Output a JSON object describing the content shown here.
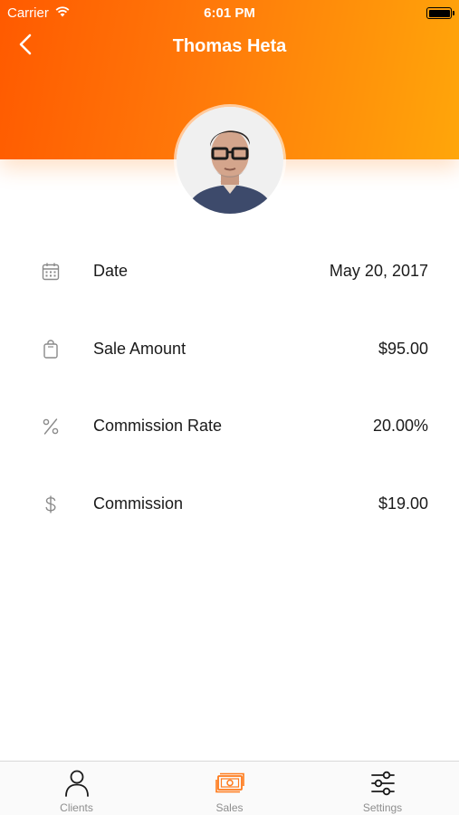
{
  "status_bar": {
    "carrier": "Carrier",
    "time": "6:01 PM"
  },
  "header": {
    "title": "Thomas Heta",
    "back_icon": "chevron-left-icon"
  },
  "colors": {
    "accent": "#ff7a0a",
    "gradient_start": "#ff5a00",
    "gradient_end": "#ffa60a",
    "tab_inactive": "#8e8e8e",
    "tab_active": "#ff7a1a"
  },
  "details": [
    {
      "icon": "calendar-icon",
      "label": "Date",
      "value": "May 20, 2017"
    },
    {
      "icon": "shopping-bag-icon",
      "label": "Sale Amount",
      "value": "$95.00"
    },
    {
      "icon": "percent-icon",
      "label": "Commission Rate",
      "value": "20.00%"
    },
    {
      "icon": "dollar-icon",
      "label": "Commission",
      "value": "$19.00"
    }
  ],
  "tab_bar": {
    "tabs": [
      {
        "label": "Clients",
        "icon": "person-icon",
        "active": false
      },
      {
        "label": "Sales",
        "icon": "cash-icon",
        "active": true
      },
      {
        "label": "Settings",
        "icon": "sliders-icon",
        "active": false
      }
    ]
  }
}
